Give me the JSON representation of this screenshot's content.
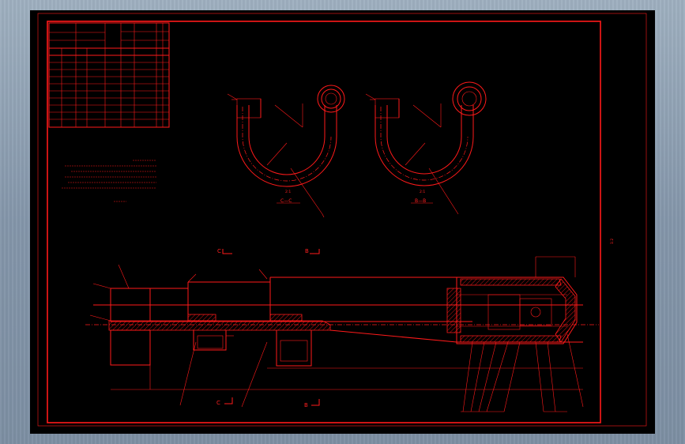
{
  "drawing": {
    "section_c_label": "C",
    "section_b_label": "B",
    "view_c_caption": "C—C",
    "view_b_caption": "B—B",
    "view_scale": "2:1",
    "side_label": "1:2"
  },
  "colors": {
    "line": "#ff1a1a",
    "background": "#000000",
    "chrome": "#8496aa"
  }
}
